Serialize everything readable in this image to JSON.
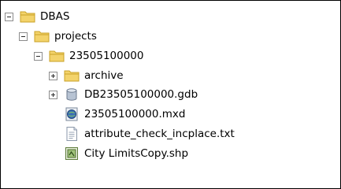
{
  "tree": {
    "root": {
      "label": "DBAS",
      "state": "expanded",
      "icon": "folder-icon"
    },
    "projects": {
      "label": "projects",
      "state": "expanded",
      "icon": "folder-icon"
    },
    "project_folder": {
      "label": "23505100000",
      "state": "expanded",
      "icon": "folder-icon"
    },
    "archive": {
      "label": "archive",
      "state": "collapsed",
      "icon": "folder-icon"
    },
    "gdb": {
      "label": "DB23505100000.gdb",
      "state": "collapsed",
      "icon": "geodatabase-icon"
    },
    "mxd": {
      "label": "23505100000.mxd",
      "icon": "map-document-icon"
    },
    "txt": {
      "label": "attribute_check_incplace.txt",
      "icon": "text-file-icon"
    },
    "shp": {
      "label": "City LimitsCopy.shp",
      "icon": "shapefile-icon"
    }
  },
  "colors": {
    "folder": "#f3d36b",
    "folder_edge": "#c9a227",
    "geodatabase": "#b7c3d3",
    "mxd_globe": "#3b6fb6",
    "shapefile": "#9fc37a"
  }
}
